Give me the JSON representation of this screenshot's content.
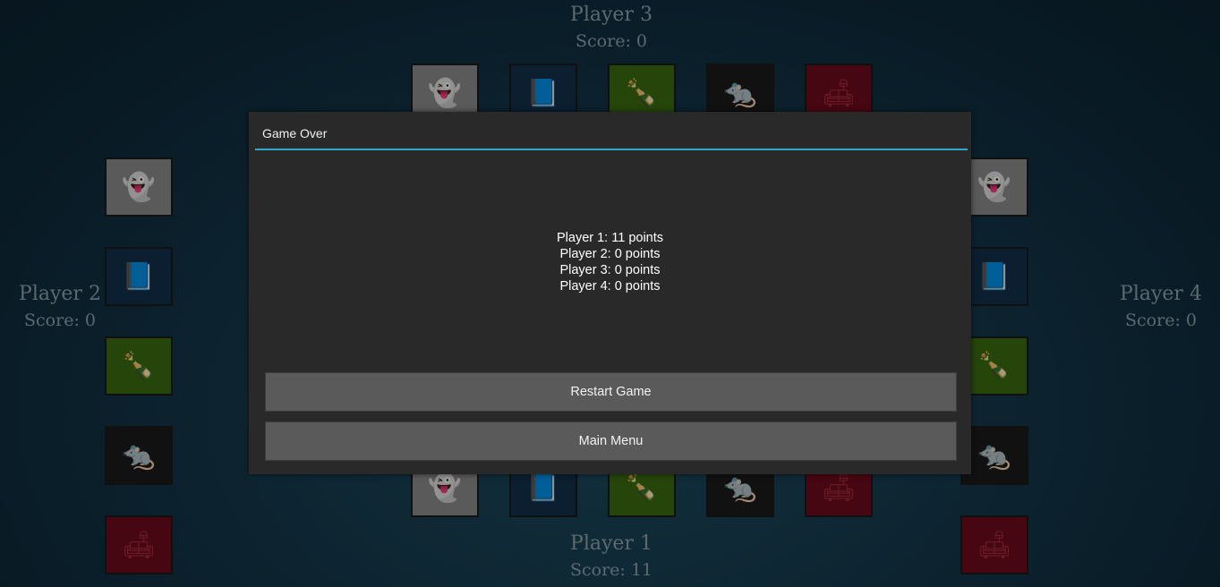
{
  "players": {
    "p1": {
      "name": "Player 1",
      "score": "Score: 11"
    },
    "p2": {
      "name": "Player 2",
      "score": "Score: 0"
    },
    "p3": {
      "name": "Player 3",
      "score": "Score: 0"
    },
    "p4": {
      "name": "Player 4",
      "score": "Score: 0"
    }
  },
  "card_types": [
    "ghost",
    "book",
    "bottle",
    "rat",
    "sofa"
  ],
  "icons": {
    "ghost": "ghost-icon",
    "book": "book-icon",
    "bottle": "bottle-icon",
    "rat": "rat-icon",
    "sofa": "sofa-icon"
  },
  "colors": {
    "ghost": "#8a8a8a",
    "book": "#12304a",
    "bottle": "#3b6b12",
    "rat": "#1b1b1b",
    "sofa": "#6e0c1c",
    "accent": "#33a6cc",
    "dialog_bg": "#292929",
    "button_bg": "#5a5a5a"
  },
  "dialog": {
    "title": "Game Over",
    "results": [
      "Player 1: 11 points",
      "Player 2: 0 points",
      "Player 3: 0 points",
      "Player 4: 0 points"
    ],
    "restart_label": "Restart Game",
    "menu_label": "Main Menu"
  }
}
